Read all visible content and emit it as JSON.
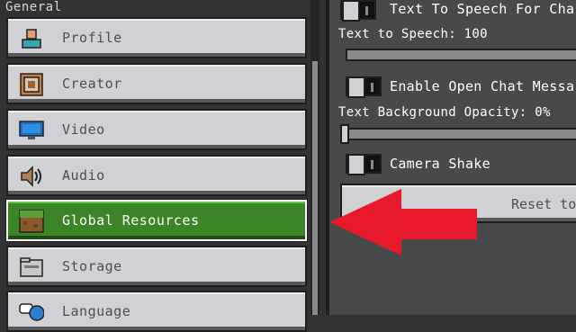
{
  "section_title": "General",
  "nav": {
    "items": [
      {
        "label": "Profile",
        "icon": "profile-icon",
        "selected": false
      },
      {
        "label": "Creator",
        "icon": "creator-icon",
        "selected": false
      },
      {
        "label": "Video",
        "icon": "video-icon",
        "selected": false
      },
      {
        "label": "Audio",
        "icon": "audio-icon",
        "selected": false
      },
      {
        "label": "Global Resources",
        "icon": "global-resources-icon",
        "selected": true
      },
      {
        "label": "Storage",
        "icon": "storage-icon",
        "selected": false
      },
      {
        "label": "Language",
        "icon": "language-icon",
        "selected": false
      }
    ]
  },
  "settings": {
    "tts_toggle_label": "Text To Speech For Cha",
    "tts_slider_label": "Text to Speech: 100",
    "tts_slider_value": 100,
    "open_chat_label": "Enable Open Chat Messa",
    "bg_opacity_label": "Text Background Opacity: 0%",
    "bg_opacity_value": 0,
    "camera_shake_label": "Camera Shake",
    "reset_label": "Reset to"
  },
  "colors": {
    "selected": "#3c8527",
    "button": "#d0d1d4",
    "arrow": "#e8192c"
  }
}
